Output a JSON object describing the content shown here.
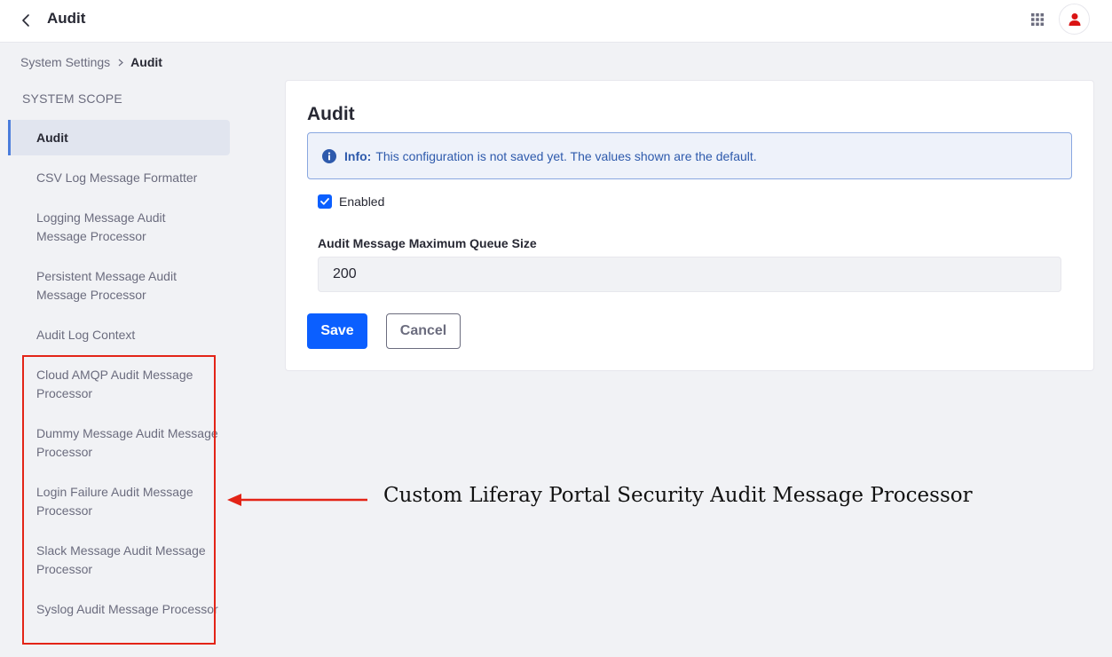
{
  "header": {
    "title": "Audit",
    "back_icon": "chevron-left-icon",
    "apps_icon": "grid-icon",
    "avatar_icon": "user-icon",
    "avatar_color": "#da1414"
  },
  "breadcrumb": {
    "parent": "System Settings",
    "current": "Audit"
  },
  "sidebar": {
    "scope_label": "SYSTEM SCOPE",
    "active_color": "#4b7ddc",
    "items": [
      {
        "label": "Audit",
        "active": true
      },
      {
        "label": "CSV Log Message Formatter"
      },
      {
        "label": "Logging Message Audit Message Processor"
      },
      {
        "label": "Persistent Message Audit Message Processor"
      },
      {
        "label": "Audit Log Context"
      },
      {
        "label": "Cloud AMQP Audit Message Processor"
      },
      {
        "label": "Dummy Message Audit Message Processor"
      },
      {
        "label": "Login Failure Audit Message Processor"
      },
      {
        "label": "Slack Message Audit Message Processor"
      },
      {
        "label": "Syslog Audit Message Processor"
      }
    ]
  },
  "annotation": {
    "text": "Custom Liferay Portal Security Audit Message Processor",
    "color": "#e32417"
  },
  "form": {
    "title": "Audit",
    "alert": {
      "lead": "Info:",
      "message": "This configuration is not saved yet. The values shown are the default.",
      "icon": "info-circle-icon"
    },
    "enabled": {
      "label": "Enabled",
      "checked": true
    },
    "queue_size": {
      "label": "Audit Message Maximum Queue Size",
      "value": "200"
    },
    "save_label": "Save",
    "cancel_label": "Cancel",
    "primary_color": "#0b5fff"
  }
}
